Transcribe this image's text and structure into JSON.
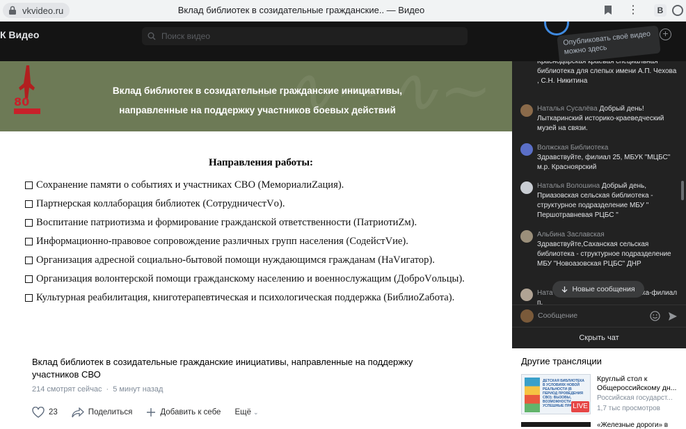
{
  "browser": {
    "url": "vkvideo.ru",
    "tab_title": "Вклад библиотек в созидательные гражданские.. — Видео",
    "extension_label": "В"
  },
  "site": {
    "logo": "К Видео",
    "search_placeholder": "Поиск видео",
    "publish_tooltip": "Опубликовать своё видео можно здесь"
  },
  "slide": {
    "banner_title_line1": "Вклад библиотек в созидательные гражданские инициативы,",
    "banner_title_line2": "направленные на поддержку участников боевых действий",
    "emblem_number": "80",
    "heading": "Направления работы:",
    "directions": [
      "Сохранение памяти о событиях и участниках СВО (МемориалиZация).",
      "Партнерская коллаборация библиотек (СотрудничестVо).",
      "Воспитание патриотизма и формирование гражданской ответственности (ПатриотиZм).",
      "Информационно-правовое сопровождение различных групп населения (СодейстVие).",
      "Организация адресной социально-бытовой помощи нуждающимся гражданам (НаVигатор).",
      "Организация волонтерской помощи гражданскому населению и военнослужащим (ДоброVольцы).",
      "Культурная реабилитация, книготерапевтическая и психологическая поддержка (БиблиоZабота)."
    ]
  },
  "chat": {
    "messages": [
      {
        "author": "",
        "text": "Краснодарская краевая специальная библиотека для слепых имени А.П. Чехова , С.Н. Никитина",
        "avatar_color": "#7a5a3a"
      },
      {
        "author": "Наталья Сусалёва",
        "text": "Добрый день! Лыткаринский историко-краеведческий музей на связи.",
        "avatar_color": "#8a6a4a"
      },
      {
        "author": "Волжская Библиотека",
        "text": "Здравствуйте, филиал 25, МБУК \"МЦБС\" м.р. Красноярский",
        "avatar_color": "#5b6fc7"
      },
      {
        "author": "Наталья Волошина",
        "text": "Добрый день, Приазовская сельская библиотека - структурное подразделение МБУ \" Першотравневая РЦБС \"",
        "avatar_color": "#c9cdd3"
      },
      {
        "author": "Альбина Заславская",
        "text": "Здравствуйте,Саханская сельская библиотека - структурное подразделение МБУ \"Новоазовская РЦБС\" ДНР",
        "avatar_color": "#9b8f7a"
      },
      {
        "author": "Ната",
        "text": "вас приветствует библиотека-филиал п.",
        "avatar_color": "#b0a394"
      }
    ],
    "new_messages_label": "Новые сообщения",
    "input_placeholder": "Сообщение",
    "hide_chat_label": "Скрыть чат"
  },
  "video": {
    "title": "Вклад библиотек в созидательные гражданские инициативы, направленные на поддержку участников СВО",
    "viewers": "214 смотрят сейчас",
    "time_ago": "5 минут назад",
    "likes": "23",
    "share_label": "Поделиться",
    "add_label": "Добавить к себе",
    "more_label": "Ещё"
  },
  "other_streams": {
    "heading": "Другие трансляции",
    "items": [
      {
        "title": "Круглый стол к Общероссийскому дн...",
        "channel": "Российская государст...",
        "views": "1,7 тыс просмотров",
        "badge": "LIVE",
        "thumb_text": "ДЕТСКАЯ БИБЛИОТЕКА В УСЛОВИЯХ НОВОЙ РЕАЛЬНОСТИ (В ПЕРИОД ПРОВЕДЕНИЯ СВО): ВЫЗОВЫ, ВОЗМОЖНОСТИ, УСПЕШНЫЕ ПРАКТИКИ"
      },
      {
        "title": "«Железные дороги» в"
      }
    ]
  }
}
